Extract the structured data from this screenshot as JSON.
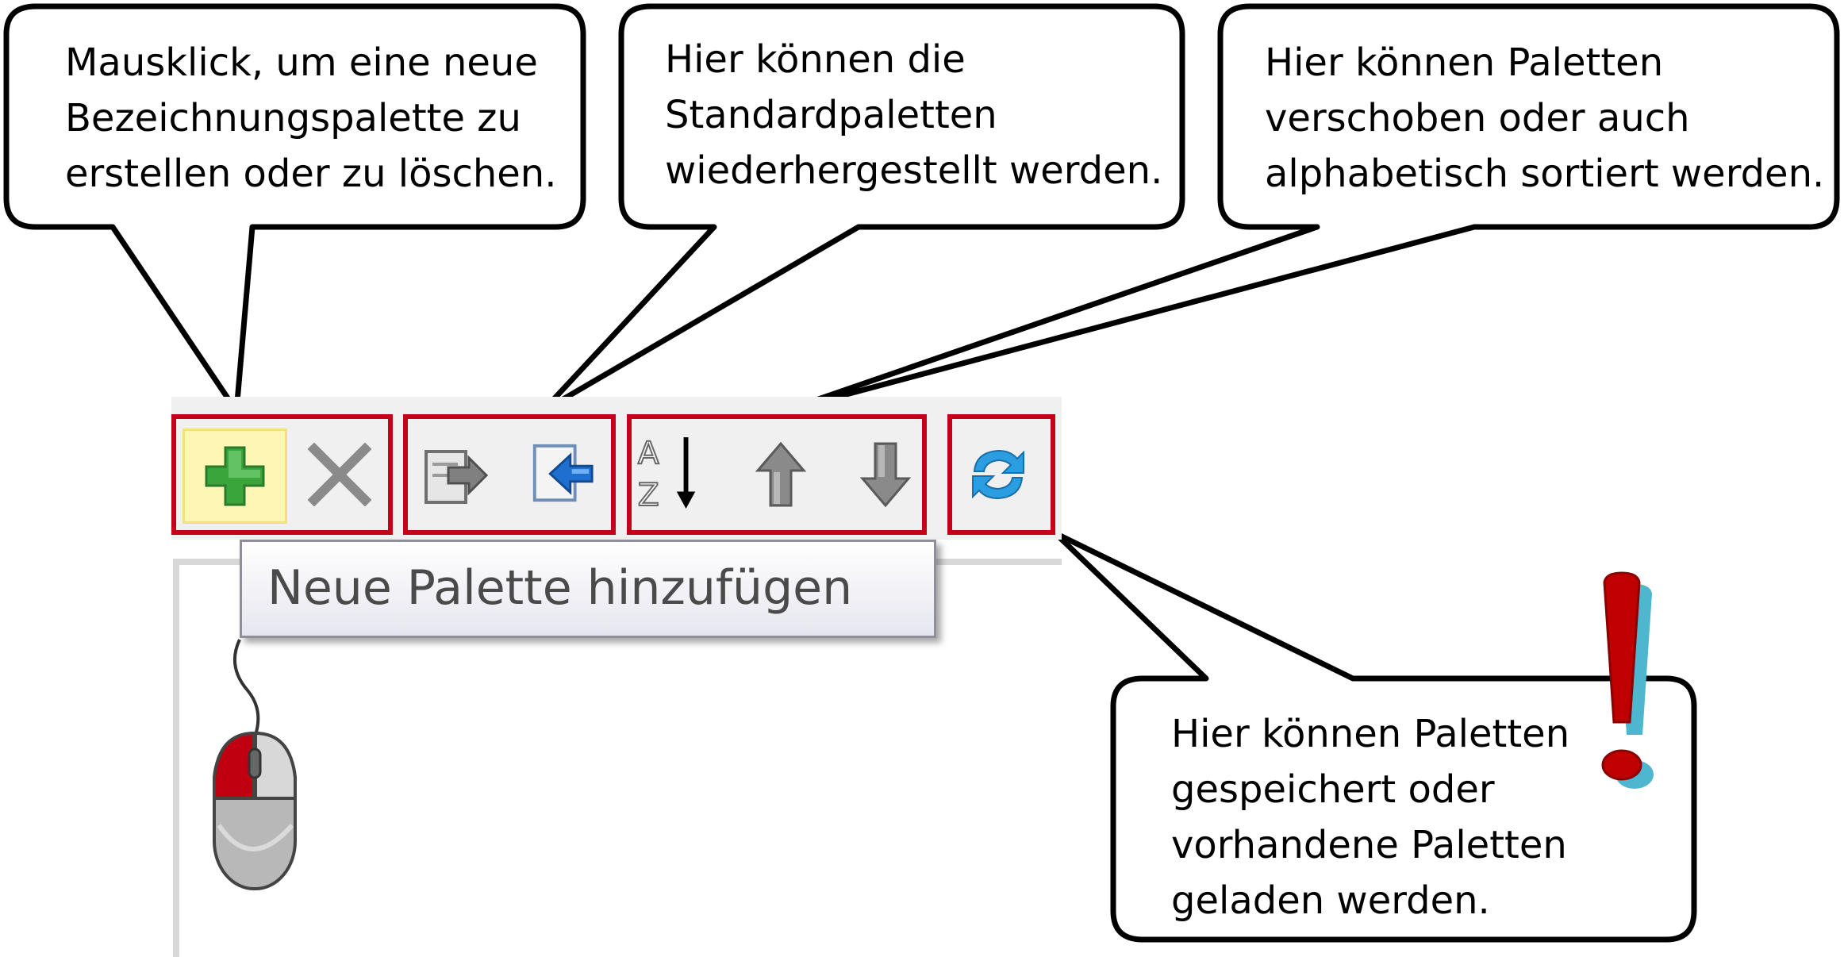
{
  "callouts": {
    "add_delete": [
      "Mausklick, um eine neue",
      "Bezeichnungspalette zu",
      "erstellen oder zu löschen."
    ],
    "restore": [
      "Hier können die",
      "Standardpaletten",
      "wiederhergestellt werden."
    ],
    "sort": [
      "Hier können Paletten",
      "verschoben oder auch",
      "alphabetisch sortiert werden."
    ],
    "save_load": [
      "Hier können Paletten",
      "gespeichert oder",
      "vorhandene Paletten",
      "geladen werden."
    ]
  },
  "toolbar": {
    "buttons": [
      {
        "icon": "plus-icon",
        "color": "#3aa53a"
      },
      {
        "icon": "delete-x-icon",
        "color": "#8a8a8a"
      },
      {
        "icon": "export-icon",
        "color": "#8a8a8a"
      },
      {
        "icon": "import-icon",
        "color": "#1e6fd0"
      },
      {
        "icon": "sort-az-icon",
        "color": "#000000"
      },
      {
        "icon": "move-up-icon",
        "color": "#8a8a8a"
      },
      {
        "icon": "move-down-icon",
        "color": "#8a8a8a"
      },
      {
        "icon": "refresh-icon",
        "color": "#2a9ee0"
      }
    ],
    "sort_letters": {
      "a": "A",
      "z": "Z"
    }
  },
  "tooltip": {
    "text": "Neue Palette hinzufügen"
  },
  "accent": {
    "highlight_red": "#c4001a",
    "exclamation_red": "#c00000",
    "exclamation_shadow": "#4fb6d0"
  }
}
